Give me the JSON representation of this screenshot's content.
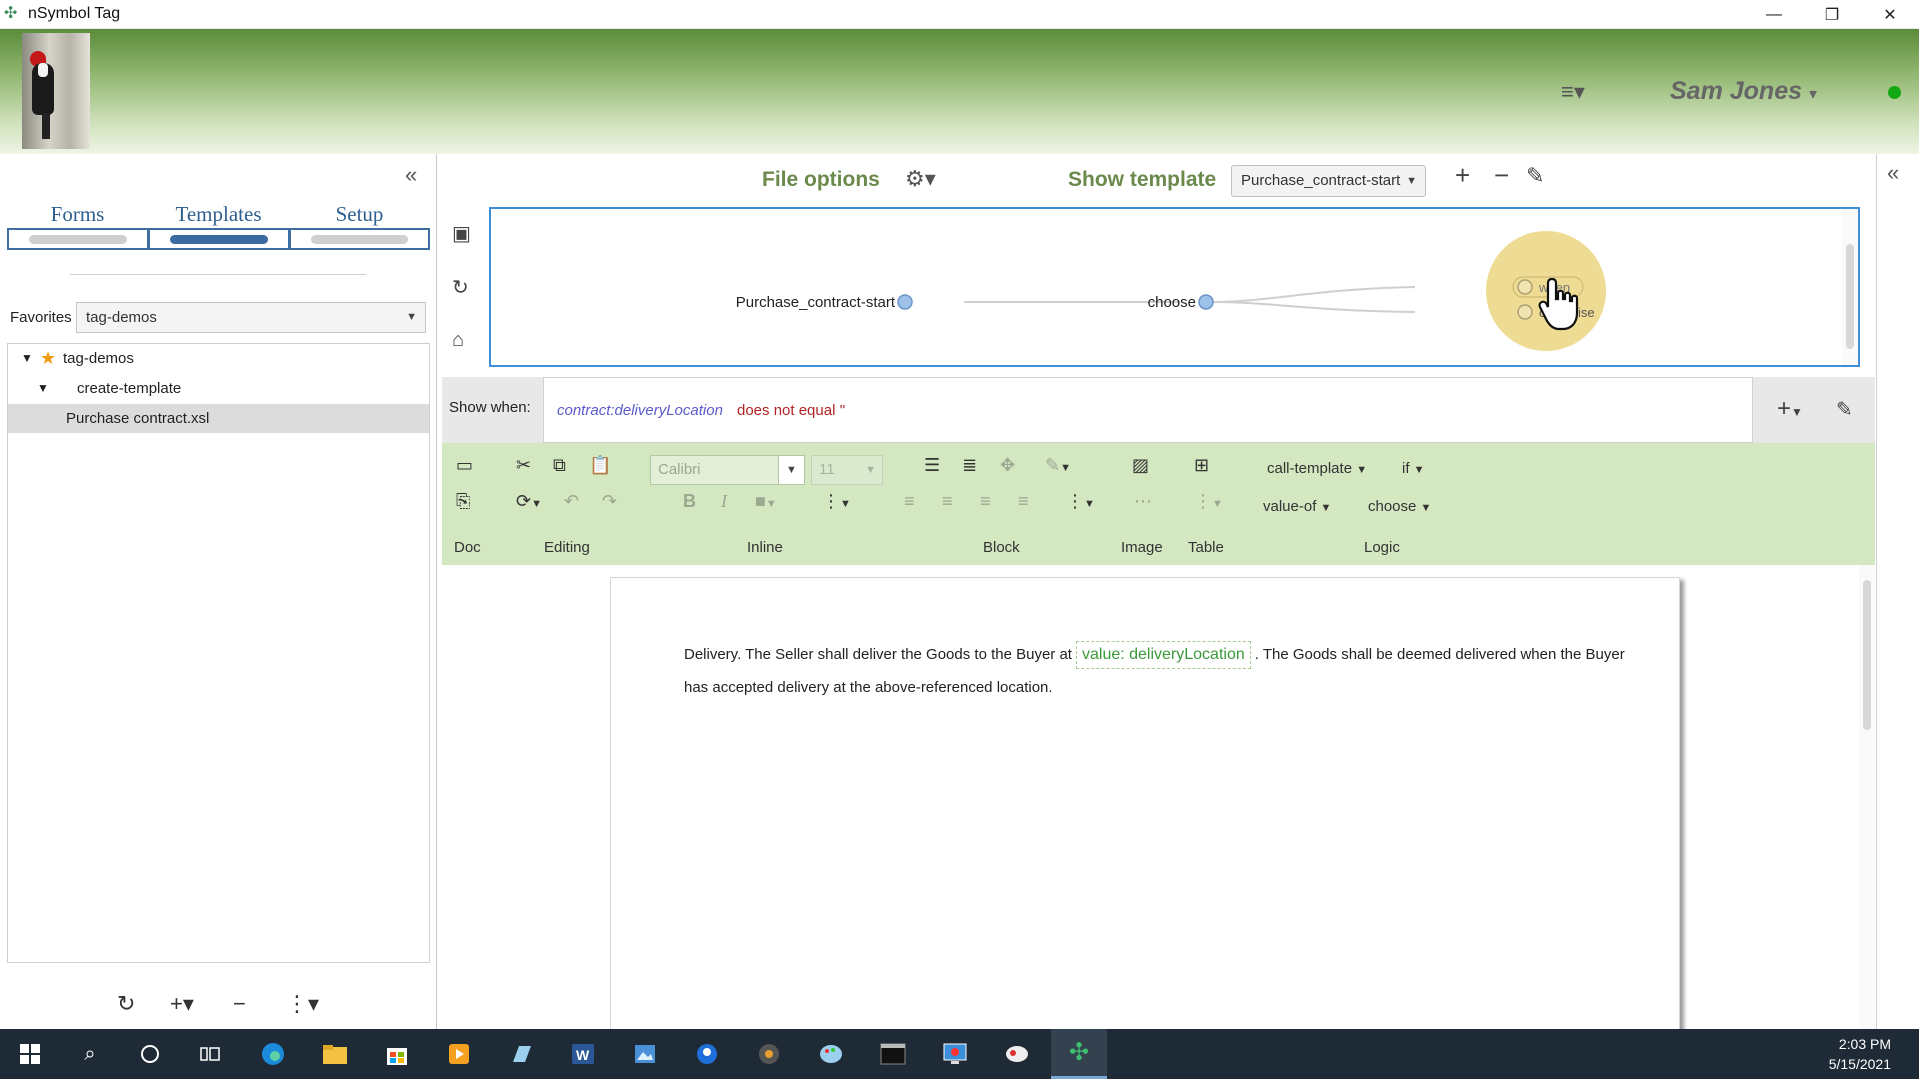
{
  "window": {
    "title": "nSymbol Tag",
    "minimize": "—",
    "restore": "❐",
    "close": "✕"
  },
  "header": {
    "user_name": "Sam Jones",
    "user_caret": "▾",
    "menu_icon": "≡▾",
    "status_color": "#12a812"
  },
  "left_panel": {
    "collapse_icon": "«",
    "tabs": [
      {
        "label": "Forms",
        "active": false
      },
      {
        "label": "Templates",
        "active": true
      },
      {
        "label": "Setup",
        "active": false
      }
    ],
    "favorites_label": "Favorites",
    "favorites_value": "tag-demos",
    "tree": [
      {
        "label": "tag-demos",
        "level": 0,
        "expanded": true,
        "star": true
      },
      {
        "label": "create-template",
        "level": 1,
        "expanded": true
      },
      {
        "label": "Purchase contract.xsl",
        "level": 2,
        "selected": true
      }
    ],
    "bottom_tools": [
      "↻",
      "+▾",
      "−",
      "⋮▾"
    ]
  },
  "main": {
    "file_options": "File options",
    "gear_icon": "⚙▾",
    "show_template": "Show template",
    "template_value": "Purchase_contract-start",
    "graph": {
      "nodes": [
        "Purchase_contract-start",
        "choose",
        "when",
        "otherwise"
      ]
    },
    "show_when_label": "Show when:",
    "show_when_var": "contract:deliveryLocation",
    "show_when_op": "does not equal ''",
    "ribbon": {
      "font_name": "Calibri",
      "font_size": "11",
      "groups": [
        "Doc",
        "Editing",
        "Inline",
        "Block",
        "Image",
        "Table",
        "Logic"
      ],
      "logic_items": [
        "call-template",
        "if",
        "value-of",
        "choose"
      ]
    },
    "document": {
      "text_before": "Delivery. The Seller shall deliver the Goods to the Buyer at",
      "chip": "value: deliveryLocation",
      "text_after": ". The Goods shall be deemed delivered when the Buyer has accepted delivery at the above-referenced location."
    }
  },
  "taskbar": {
    "time": "2:03 PM",
    "date": "5/15/2021",
    "accent": "#7aa6d6"
  }
}
